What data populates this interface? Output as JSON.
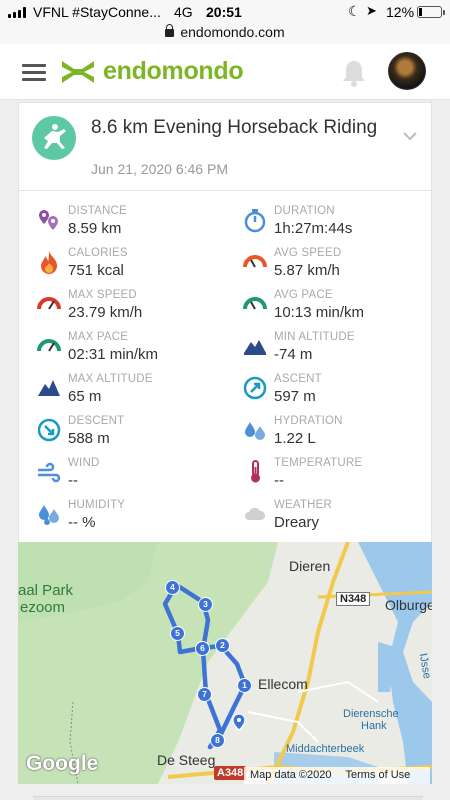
{
  "status_bar": {
    "carrier": "VFNL #StayConne...",
    "network": "4G",
    "time": "20:51",
    "battery": "12%"
  },
  "browser": {
    "url": "endomondo.com"
  },
  "header": {
    "logo_text": "endomondo",
    "brand_color": "#7cb625",
    "menu_icon": "hamburger-icon",
    "notification_icon": "bell-icon",
    "avatar_icon": "user-avatar"
  },
  "workout": {
    "title": "8.6 km Evening Horseback Riding",
    "date": "Jun 21, 2020 6:46 PM",
    "sport_icon": "horseback-riding-icon",
    "sport_color": "#5dc9a4"
  },
  "stats": [
    {
      "label": "DISTANCE",
      "value": "8.59 km",
      "icon": "distance-icon",
      "color": "#8e4dab"
    },
    {
      "label": "DURATION",
      "value": "1h:27m:44s",
      "icon": "stopwatch-icon",
      "color": "#4a8fd8"
    },
    {
      "label": "CALORIES",
      "value": "751 kcal",
      "icon": "flame-icon",
      "color": "#e8562a"
    },
    {
      "label": "AVG SPEED",
      "value": "5.87 km/h",
      "icon": "speedometer-icon",
      "color": "#e8562a"
    },
    {
      "label": "MAX SPEED",
      "value": "23.79 km/h",
      "icon": "speedometer-icon",
      "color": "#d83a2a"
    },
    {
      "label": "AVG PACE",
      "value": "10:13 min/km",
      "icon": "pace-gauge-icon",
      "color": "#1e9a6e"
    },
    {
      "label": "MAX PACE",
      "value": "02:31 min/km",
      "icon": "pace-gauge-icon",
      "color": "#1e9a6e"
    },
    {
      "label": "MIN ALTITUDE",
      "value": "-74 m",
      "icon": "mountain-icon",
      "color": "#2a4a8a"
    },
    {
      "label": "MAX ALTITUDE",
      "value": "65 m",
      "icon": "mountain-icon",
      "color": "#2a4a8a"
    },
    {
      "label": "ASCENT",
      "value": "597 m",
      "icon": "ascent-arrow-icon",
      "color": "#1a9ac0"
    },
    {
      "label": "DESCENT",
      "value": "588 m",
      "icon": "descent-arrow-icon",
      "color": "#1a9ac0"
    },
    {
      "label": "HYDRATION",
      "value": "1.22 L",
      "icon": "water-drops-icon",
      "color": "#4a8fd8"
    },
    {
      "label": "WIND",
      "value": "--",
      "icon": "wind-icon",
      "color": "#4a8fd8"
    },
    {
      "label": "TEMPERATURE",
      "value": "--",
      "icon": "thermometer-icon",
      "color": "#b03060"
    },
    {
      "label": "HUMIDITY",
      "value": "-- %",
      "icon": "humidity-drops-icon",
      "color": "#4a8fd8"
    },
    {
      "label": "WEATHER",
      "value": "Dreary",
      "icon": "cloud-icon",
      "color": "#c9c9c9"
    }
  ],
  "map": {
    "places": {
      "dieren": "Dieren",
      "park": "aal Park",
      "zoom": "ezoom",
      "olburgen": "Olburge",
      "ellecom": "Ellecom",
      "hank1": "Dierensche",
      "hank2": "Hank",
      "middachterbeek": "Middachterbeek",
      "ijssel": "IJsse",
      "desteeg": "De Steeg"
    },
    "road_n348": "N348",
    "road_a348": "A348",
    "route_markers": [
      "1",
      "2",
      "3",
      "4",
      "5",
      "6",
      "7",
      "8"
    ],
    "google": "Google",
    "map_data": "Map data ©2020",
    "terms": "Terms of Use"
  }
}
